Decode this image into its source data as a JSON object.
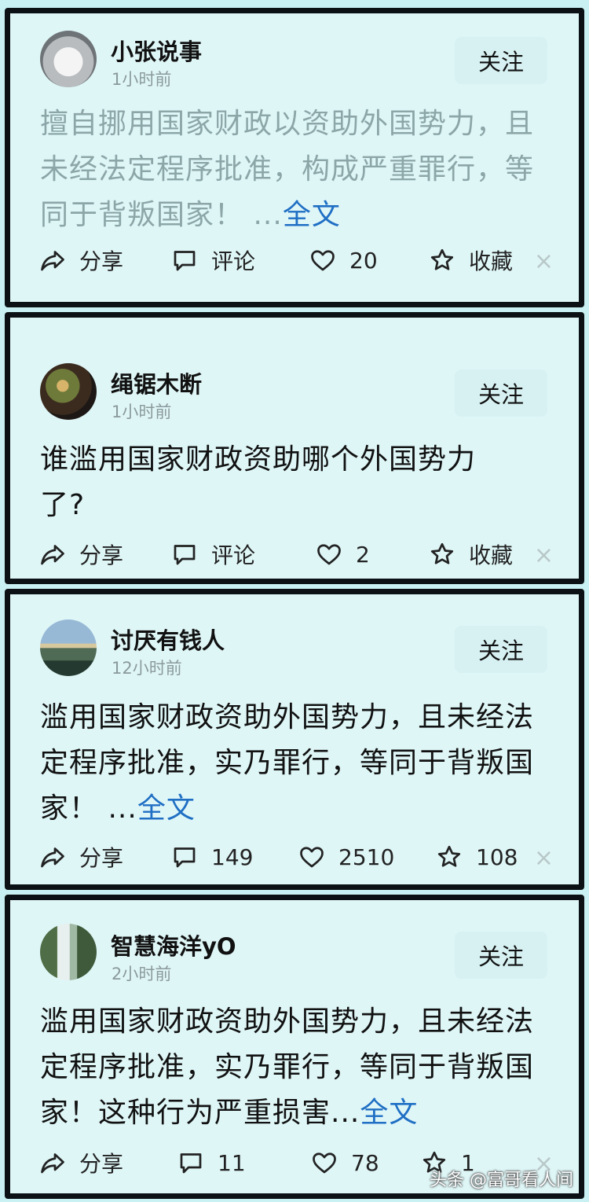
{
  "posts": [
    {
      "username": "小张说事",
      "time": "1小时前",
      "follow_label": "关注",
      "text": "擅自挪用国家财政以资助外国势力，且未经法定程序批准，构成严重罪行，等同于背叛国家！",
      "ellipsis": "...",
      "more_label": "全文",
      "share_label": "分享",
      "comment_label": "评论",
      "likes": "20",
      "collect_label": "收藏"
    },
    {
      "username": "绳锯木断",
      "time": "1小时前",
      "follow_label": "关注",
      "text": "谁滥用国家财政资助哪个外国势力了?",
      "share_label": "分享",
      "comment_label": "评论",
      "likes": "2",
      "collect_label": "收藏"
    },
    {
      "username": "讨厌有钱人",
      "time": "12小时前",
      "follow_label": "关注",
      "text": "滥用国家财政资助外国势力，且未经法定程序批准，实乃罪行，等同于背叛国家！",
      "ellipsis": "...",
      "more_label": "全文",
      "share_label": "分享",
      "comments": "149",
      "likes": "2510",
      "collects": "108"
    },
    {
      "username": "智慧海洋yO",
      "time": "2小时前",
      "follow_label": "关注",
      "text": "滥用国家财政资助外国势力，且未经法定程序批准，实乃罪行，等同于背叛国家！这种行为严重损害",
      "ellipsis": "...",
      "more_label": "全文",
      "share_label": "分享",
      "comments": "11",
      "likes": "78",
      "collects": "1"
    }
  ],
  "close_glyph": "×",
  "watermark": "头条 @富哥看人间",
  "colors": {
    "link": "#1f6fc4",
    "faded_text": "#8ca6a8",
    "border": "#0b1114"
  }
}
